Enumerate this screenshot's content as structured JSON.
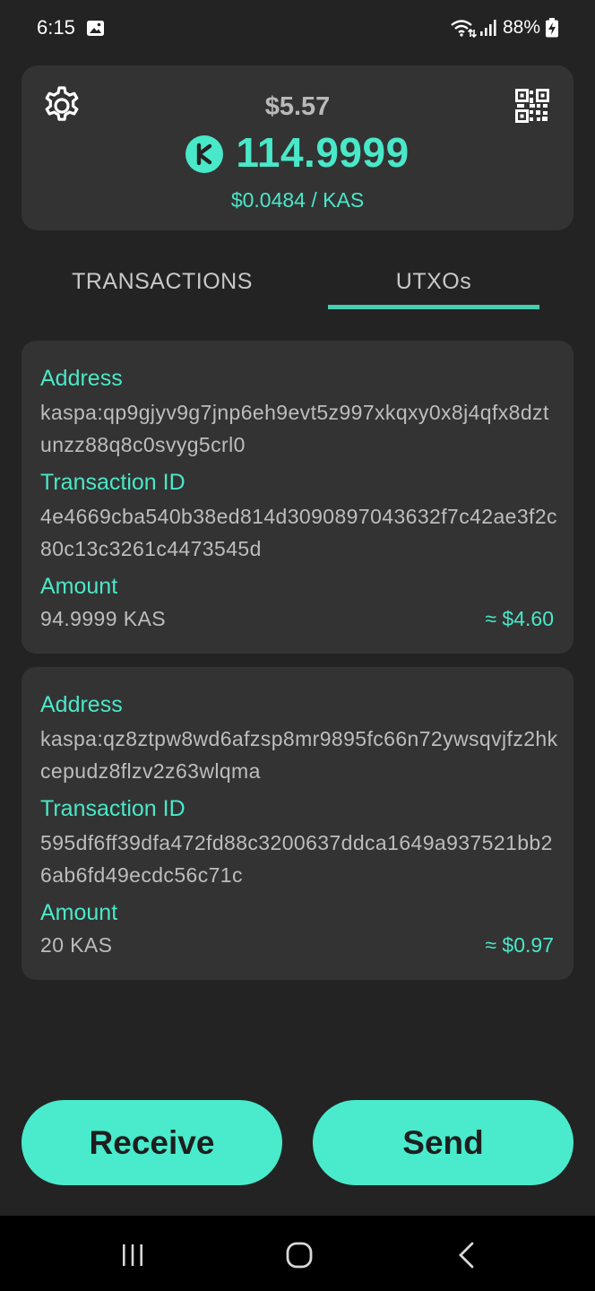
{
  "status_bar": {
    "time": "6:15",
    "battery": "88%",
    "icons": [
      "gallery-icon",
      "wifi-icon",
      "signal-icon",
      "battery-charging-icon"
    ]
  },
  "balance": {
    "usd": "$5.57",
    "kas": "114.9999",
    "rate": "$0.0484 / KAS",
    "icons": [
      "settings-icon",
      "qr-code-icon",
      "kaspa-logo-icon"
    ]
  },
  "tabs": [
    {
      "label": "TRANSACTIONS",
      "active": false
    },
    {
      "label": "UTXOs",
      "active": true
    }
  ],
  "labels": {
    "address": "Address",
    "transaction_id": "Transaction ID",
    "amount": "Amount"
  },
  "utxos": [
    {
      "address": "kaspa:qp9gjyv9g7jnp6eh9evt5z997xkqxy0x8j4qfx8dztunzz88q8c0svyg5crl0",
      "transaction_id": "4e4669cba540b38ed814d3090897043632f7c42ae3f2c80c13c3261c4473545d",
      "amount": "94.9999 KAS",
      "amount_usd": "≈ $4.60"
    },
    {
      "address": "kaspa:qz8ztpw8wd6afzsp8mr9895fc66n72ywsqvjfz2hkcepudz8flzv2z63wlqma",
      "transaction_id": "595df6ff39dfa472fd88c3200637ddca1649a937521bb26ab6fd49ecdc56c71c",
      "amount": "20 KAS",
      "amount_usd": "≈ $0.97"
    }
  ],
  "actions": {
    "receive_label": "Receive",
    "send_label": "Send"
  },
  "colors": {
    "background": "#232323",
    "card": "#333333",
    "accent": "#49e8c8",
    "button": "#49ebcc"
  }
}
